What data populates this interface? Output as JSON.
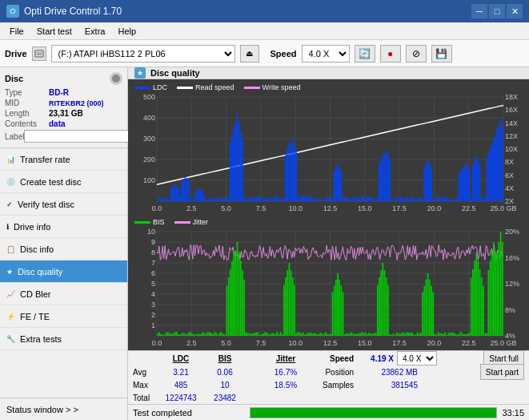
{
  "app": {
    "title": "Opti Drive Control 1.70",
    "icon": "disc-icon"
  },
  "titlebar": {
    "minimize_label": "─",
    "maximize_label": "□",
    "close_label": "✕"
  },
  "menubar": {
    "items": [
      "File",
      "Start test",
      "Extra",
      "Help"
    ]
  },
  "drivebar": {
    "label": "Drive",
    "drive_value": "(F:)  ATAPI iHBS112  2 PL06",
    "speed_label": "Speed",
    "speed_value": "4.0 X"
  },
  "disc_panel": {
    "title": "Disc",
    "rows": [
      {
        "label": "Type",
        "value": "BD-R"
      },
      {
        "label": "MID",
        "value": "RITEKBR2 (000)"
      },
      {
        "label": "Length",
        "value": "23,31 GB"
      },
      {
        "label": "Contents",
        "value": "data"
      },
      {
        "label": "Label",
        "value": ""
      }
    ]
  },
  "nav_items": [
    {
      "label": "Transfer rate",
      "icon": "📊",
      "active": false
    },
    {
      "label": "Create test disc",
      "icon": "💿",
      "active": false
    },
    {
      "label": "Verify test disc",
      "icon": "✓",
      "active": false
    },
    {
      "label": "Drive info",
      "icon": "ℹ",
      "active": false
    },
    {
      "label": "Disc info",
      "icon": "📋",
      "active": false
    },
    {
      "label": "Disc quality",
      "icon": "★",
      "active": true
    },
    {
      "label": "CD Bler",
      "icon": "📈",
      "active": false
    },
    {
      "label": "FE / TE",
      "icon": "⚡",
      "active": false
    },
    {
      "label": "Extra tests",
      "icon": "🔧",
      "active": false
    }
  ],
  "status_window": {
    "label": "Status window > >"
  },
  "disc_quality": {
    "title": "Disc quality",
    "legend": {
      "ldc_label": "LDC",
      "read_label": "Read speed",
      "write_label": "Write speed",
      "bis_label": "BIS",
      "jitter_label": "Jitter"
    }
  },
  "stats": {
    "headers": {
      "ldc": "LDC",
      "bis": "BIS",
      "jitter": "Jitter",
      "speed": "Speed",
      "position": "Position",
      "samples": "Samples"
    },
    "avg_label": "Avg",
    "max_label": "Max",
    "total_label": "Total",
    "avg_ldc": "3.21",
    "avg_bis": "0.06",
    "avg_jitter": "16.7%",
    "max_ldc": "485",
    "max_bis": "10",
    "max_jitter": "18.5%",
    "total_ldc": "1224743",
    "total_bis": "23482",
    "speed_value": "4.19 X",
    "speed_select": "4.0 X",
    "position": "23862 MB",
    "samples": "381545",
    "jitter_checked": true,
    "jitter_label": "Jitter",
    "start_full_label": "Start full",
    "start_part_label": "Start part"
  },
  "bottom_bar": {
    "status_text": "Test completed",
    "progress_percent": 100,
    "time": "33:15"
  },
  "charts": {
    "upper": {
      "y_max": 500,
      "y_labels": [
        "500",
        "400",
        "300",
        "200",
        "100"
      ],
      "y_right_labels": [
        "18X",
        "16X",
        "14X",
        "12X",
        "10X",
        "8X",
        "6X",
        "4X",
        "2X"
      ],
      "x_labels": [
        "0.0",
        "2.5",
        "5.0",
        "7.5",
        "10.0",
        "12.5",
        "15.0",
        "17.5",
        "20.0",
        "22.5",
        "25.0 GB"
      ]
    },
    "lower": {
      "y_max": 10,
      "y_labels": [
        "10",
        "9",
        "8",
        "7",
        "6",
        "5",
        "4",
        "3",
        "2",
        "1"
      ],
      "y_right_labels": [
        "20%",
        "16%",
        "12%",
        "8%",
        "4%"
      ],
      "x_labels": [
        "0.0",
        "2.5",
        "5.0",
        "7.5",
        "10.0",
        "12.5",
        "15.0",
        "17.5",
        "20.0",
        "22.5",
        "25.0 GB"
      ]
    }
  }
}
